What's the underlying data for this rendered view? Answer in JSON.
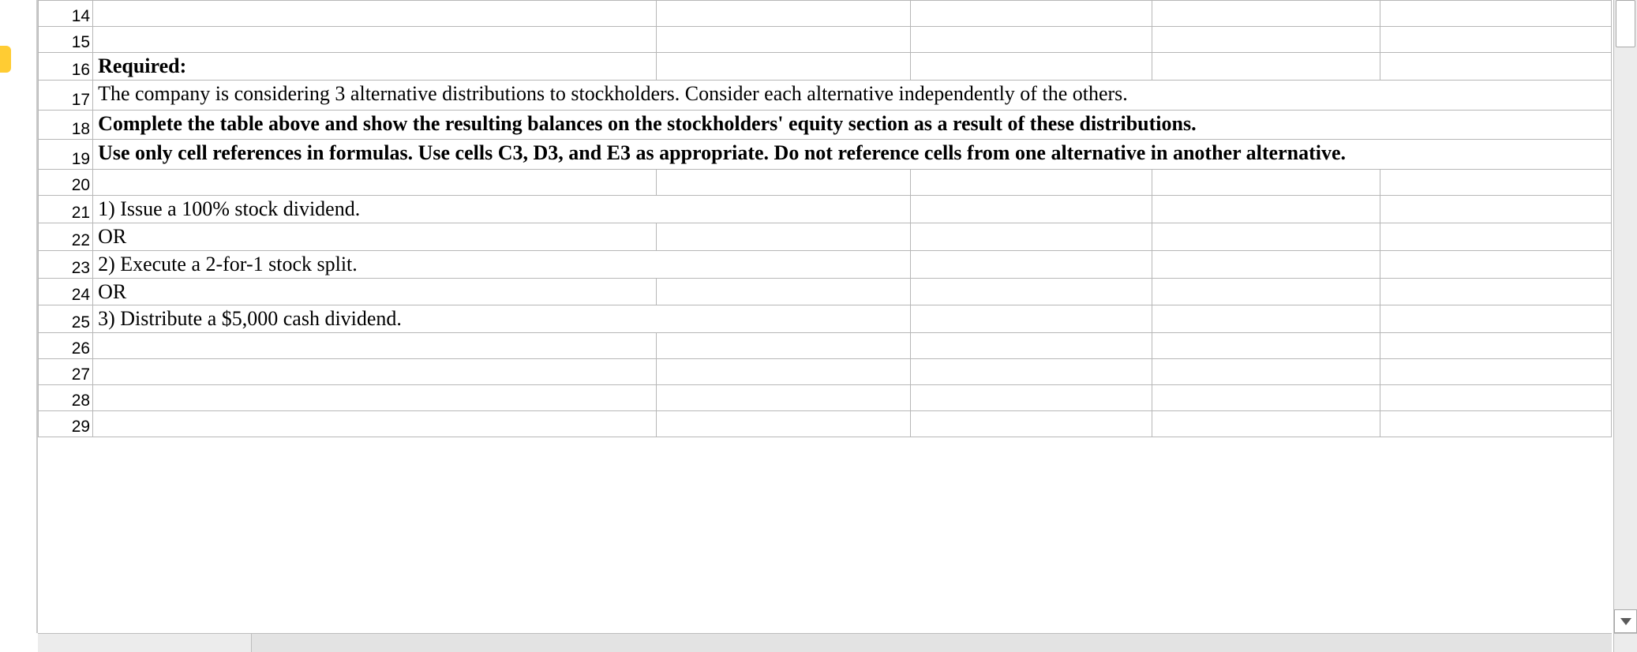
{
  "rows": {
    "14": "14",
    "15": "15",
    "16": "16",
    "17": "17",
    "18": "18",
    "19": "19",
    "20": "20",
    "21": "21",
    "22": "22",
    "23": "23",
    "24": "24",
    "25": "25",
    "26": "26",
    "27": "27",
    "28": "28",
    "29": "29"
  },
  "cells": {
    "b16": "Required:",
    "b17": "The company is considering 3 alternative distributions to stockholders.  Consider each alternative independently of the others.",
    "b18": "Complete the table above and show the resulting balances on the stockholders' equity section as a result of these distributions.",
    "b19": "Use only cell references in formulas.  Use cells C3, D3, and E3 as appropriate.  Do not reference cells from one alternative in another alternative.",
    "b21": "1) Issue a 100% stock dividend.",
    "b22": "OR",
    "b23": "2) Execute a 2-for-1 stock split.",
    "b24": "OR",
    "b25": "3) Distribute a $5,000 cash dividend."
  }
}
